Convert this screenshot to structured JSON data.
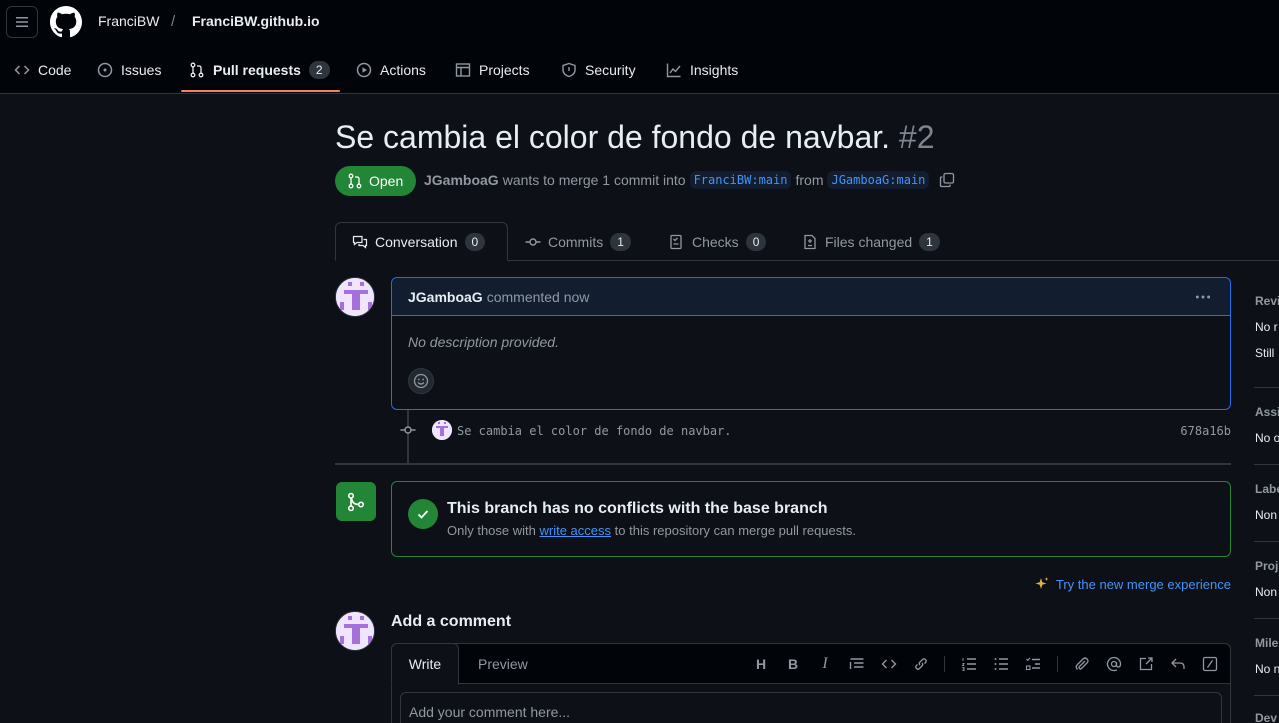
{
  "repo": {
    "owner": "FranciBW",
    "separator": "/",
    "name": "FranciBW.github.io"
  },
  "nav": {
    "code": "Code",
    "issues": "Issues",
    "pull_requests": "Pull requests",
    "pull_requests_count": "2",
    "actions": "Actions",
    "projects": "Projects",
    "security": "Security",
    "insights": "Insights"
  },
  "pr": {
    "title": "Se cambia el color de fondo de navbar.",
    "number": "#2",
    "state": "Open",
    "author": "JGamboaG",
    "merge_text": "wants to merge 1 commit into",
    "base_branch": "FranciBW:main",
    "from_text": "from",
    "head_branch": "JGamboaG:main"
  },
  "tabs": {
    "conversation": "Conversation",
    "conversation_count": "0",
    "commits": "Commits",
    "commits_count": "1",
    "checks": "Checks",
    "checks_count": "0",
    "files_changed": "Files changed",
    "files_count": "1"
  },
  "comment": {
    "author": "JGamboaG",
    "action": "commented now",
    "body": "No description provided."
  },
  "commit": {
    "message": "Se cambia el color de fondo de navbar.",
    "sha": "678a16b"
  },
  "merge": {
    "title": "This branch has no conflicts with the base branch",
    "sub_before": "Only those with",
    "sub_link": "write access",
    "sub_after": "to this repository can merge pull requests.",
    "try_new": "Try the new merge experience"
  },
  "add_comment": {
    "title": "Add a comment",
    "write": "Write",
    "preview": "Preview",
    "placeholder": "Add your comment here..."
  },
  "sidebar": {
    "reviewers": "Revi",
    "reviewers_val1": "No r",
    "reviewers_val2": "Still",
    "assignees": "Assi",
    "assignees_val": "No o",
    "labels": "Labe",
    "labels_val": "Non",
    "projects": "Proj",
    "projects_val": "Non",
    "milestone": "Mile",
    "milestone_val": "No n",
    "development": "Dev"
  },
  "colors": {
    "background": "#0d1117",
    "header": "#010409",
    "open_green": "#238636",
    "link_blue": "#4493f8",
    "underline_orange": "#f78166",
    "comment_border": "#1f6feb"
  }
}
